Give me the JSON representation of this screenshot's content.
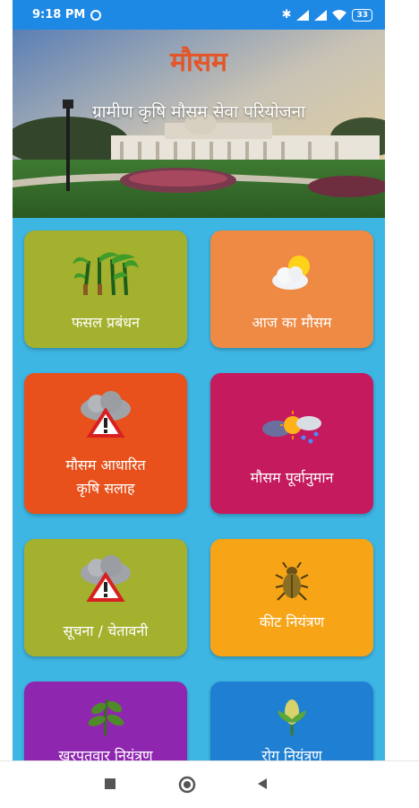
{
  "status_bar": {
    "time": "9:18 PM",
    "battery": "33"
  },
  "header": {
    "title": "मौसम",
    "subtitle": "ग्रामीण कृषि मौसम सेवा परियोजना"
  },
  "tiles": [
    {
      "label": "फसल प्रबंधन",
      "icon": "sugarcane-icon",
      "color": "#a3b12e"
    },
    {
      "label": "आज का मौसम",
      "icon": "sun-cloud-icon",
      "color": "#ee8a44"
    },
    {
      "label": "मौसम आधारित",
      "label2": "कृषि सलाह",
      "icon": "storm-warning-icon",
      "color": "#e8511b"
    },
    {
      "label": "मौसम पूर्वानुमान",
      "icon": "forecast-icon",
      "color": "#c51a5e"
    },
    {
      "label": "सूचना / चेतावनी",
      "icon": "storm-warning-icon",
      "color": "#a3b12e"
    },
    {
      "label": "कीट नियंत्रण",
      "icon": "insect-icon",
      "color": "#f7a417"
    },
    {
      "label": "खरपतवार नियंत्रण",
      "icon": "weed-icon",
      "color": "#8e26b0"
    },
    {
      "label": "रोग नियंत्रण",
      "icon": "plant-disease-icon",
      "color": "#1e7fd3"
    }
  ],
  "colors": {
    "background": "#3eb6e4",
    "status_bar": "#1e88e5"
  }
}
